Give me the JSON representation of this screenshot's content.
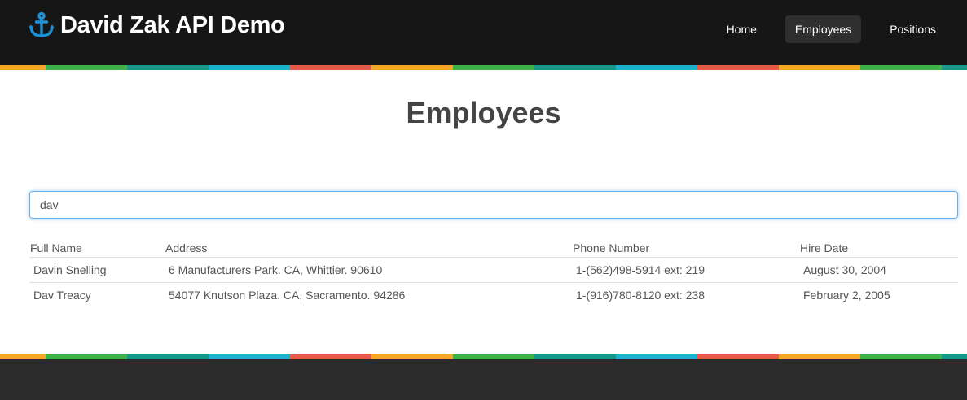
{
  "brand": {
    "title": "David Zak API Demo",
    "icon": "anchor-icon",
    "icon_color": "#1e90d6"
  },
  "nav": {
    "items": [
      {
        "label": "Home",
        "active": false
      },
      {
        "label": "Employees",
        "active": true
      },
      {
        "label": "Positions",
        "active": false
      }
    ]
  },
  "page": {
    "title": "Employees"
  },
  "search": {
    "value": "dav"
  },
  "table": {
    "headers": [
      "Full Name",
      "Address",
      "Phone Number",
      "Hire Date"
    ],
    "rows": [
      [
        "Davin Snelling",
        "6 Manufacturers Park. CA, Whittier. 90610",
        "1-(562)498-5914 ext: 219",
        "August 30, 2004"
      ],
      [
        "Dav Treacy",
        "54077 Knutson Plaza. CA, Sacramento. 94286",
        "1-(916)780-8120 ext: 238",
        "February 2, 2005"
      ]
    ]
  },
  "colors": {
    "navbar": "#161616",
    "footer": "#2b2b2b",
    "stripe": [
      "#f5a623",
      "#3db34a",
      "#14988a",
      "#1bb3c9",
      "#e8594a"
    ]
  }
}
